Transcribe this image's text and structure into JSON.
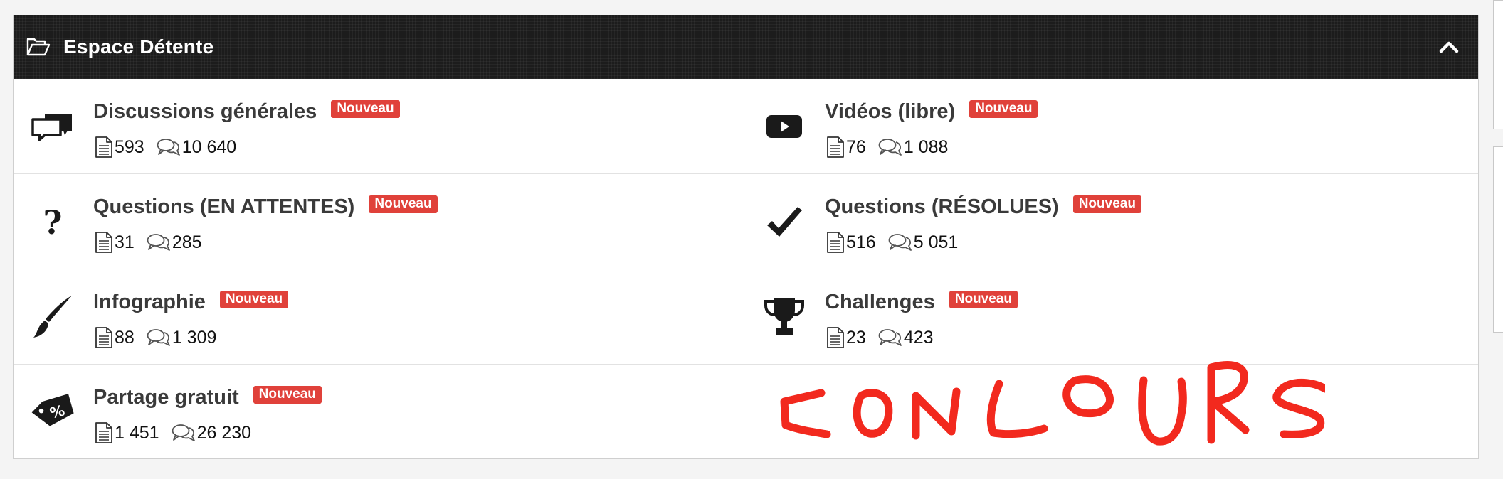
{
  "panel": {
    "title": "Espace Détente",
    "header_icon": "folder-open-icon",
    "collapse_icon": "chevron-up-icon"
  },
  "badge_color": "#e0413a",
  "forums": [
    {
      "title": "Discussions générales",
      "badge": "Nouveau",
      "icon": "chat-bubbles-icon",
      "threads": "593",
      "posts": "10 640"
    },
    {
      "title": "Vidéos (libre)",
      "badge": "Nouveau",
      "icon": "video-play-icon",
      "threads": "76",
      "posts": "1 088"
    },
    {
      "title": "Questions (EN ATTENTES)",
      "badge": "Nouveau",
      "icon": "question-icon",
      "threads": "31",
      "posts": "285"
    },
    {
      "title": "Questions (RÉSOLUES)",
      "badge": "Nouveau",
      "icon": "checkmark-icon",
      "threads": "516",
      "posts": "5 051"
    },
    {
      "title": "Infographie",
      "badge": "Nouveau",
      "icon": "paintbrush-icon",
      "threads": "88",
      "posts": "1 309"
    },
    {
      "title": "Challenges",
      "badge": "Nouveau",
      "icon": "trophy-icon",
      "threads": "23",
      "posts": "423"
    },
    {
      "title": "Partage gratuit",
      "badge": "Nouveau",
      "icon": "price-tag-percent-icon",
      "threads": "1 451",
      "posts": "26 230"
    }
  ],
  "annotation": {
    "text": "CONCOURS",
    "color": "#f2291e"
  }
}
